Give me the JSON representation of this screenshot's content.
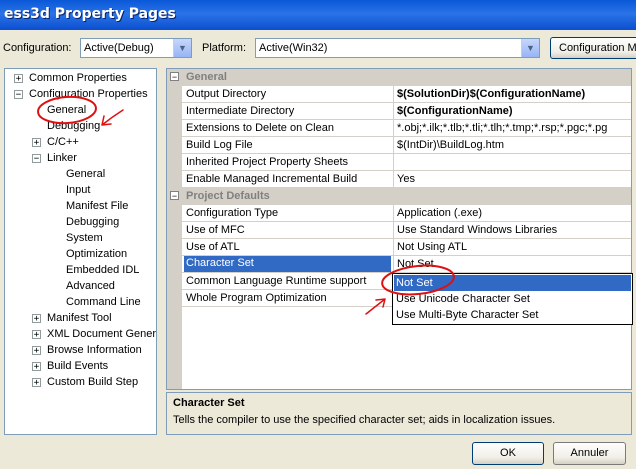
{
  "window": {
    "title": "ess3d Property Pages"
  },
  "toolbar": {
    "configuration_label": "Configuration:",
    "configuration_value": "Active(Debug)",
    "platform_label": "Platform:",
    "platform_value": "Active(Win32)",
    "config_manager_label": "Configuration M"
  },
  "tree": {
    "common_properties": "Common Properties",
    "configuration_properties": "Configuration Properties",
    "general": "General",
    "debugging": "Debugging",
    "c_cpp": "C/C++",
    "linker": "Linker",
    "linker_children": [
      "General",
      "Input",
      "Manifest File",
      "Debugging",
      "System",
      "Optimization",
      "Embedded IDL",
      "Advanced",
      "Command Line"
    ],
    "manifest_tool": "Manifest Tool",
    "xml_document_generator": "XML Document Genera",
    "browse_information": "Browse Information",
    "build_events": "Build Events",
    "custom_build_step": "Custom Build Step"
  },
  "grid": {
    "category_general": "General",
    "general_rows": [
      {
        "name": "Output Directory",
        "value": "$(SolutionDir)$(ConfigurationName)"
      },
      {
        "name": "Intermediate Directory",
        "value": "$(ConfigurationName)"
      },
      {
        "name": "Extensions to Delete on Clean",
        "value": "*.obj;*.ilk;*.tlb;*.tli;*.tlh;*.tmp;*.rsp;*.pgc;*.pg"
      },
      {
        "name": "Build Log File",
        "value": "$(IntDir)\\BuildLog.htm"
      },
      {
        "name": "Inherited Project Property Sheets",
        "value": ""
      },
      {
        "name": "Enable Managed Incremental Build",
        "value": "Yes"
      }
    ],
    "category_project_defaults": "Project Defaults",
    "project_rows": [
      {
        "name": "Configuration Type",
        "value": "Application (.exe)"
      },
      {
        "name": "Use of MFC",
        "value": "Use Standard Windows Libraries"
      },
      {
        "name": "Use of ATL",
        "value": "Not Using ATL"
      },
      {
        "name": "Character Set",
        "value": "Not Set"
      },
      {
        "name": "Common Language Runtime support",
        "value": ""
      },
      {
        "name": "Whole Program Optimization",
        "value": ""
      }
    ]
  },
  "dropdown": {
    "options": [
      "Not Set",
      "Use Unicode Character Set",
      "Use Multi-Byte Character Set"
    ]
  },
  "description": {
    "title": "Character Set",
    "text": "Tells the compiler to use the specified character set; aids in localization issues."
  },
  "buttons": {
    "ok": "OK",
    "cancel": "Annuler"
  },
  "colors": {
    "selection": "#316ac5",
    "annotation": "#e01010",
    "titlebar": "#0a58d8"
  }
}
